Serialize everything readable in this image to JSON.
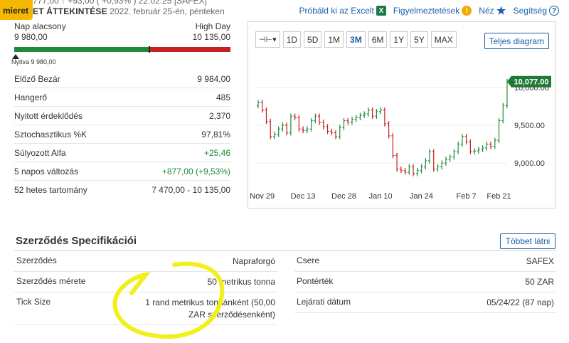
{
  "header": {
    "badge": "mieret",
    "cut_line": "777,00 ↑ +93,00 ( +0,93% )  22:02:25 [SAFEX]",
    "overview_label": "ET ÁTTEKINTÉSE",
    "date_text": "2022. február 25-én, pénteken",
    "links": {
      "excel": "Próbáld ki az Excelt",
      "alerts": "Figyelmeztetések",
      "view": "Néz",
      "help": "Segítség"
    }
  },
  "range": {
    "low_label": "Nap alacsony",
    "low_value": "9 980,00",
    "high_label": "High Day",
    "high_value": "10 135,00",
    "open_label": "Nyitva 9 980,00"
  },
  "stats": [
    {
      "label": "Előző Bezár",
      "value": "9 984,00",
      "positive": false
    },
    {
      "label": "Hangerő",
      "value": "485",
      "positive": false
    },
    {
      "label": "Nyitott érdeklődés",
      "value": "2,370",
      "positive": false
    },
    {
      "label": "Sztochasztikus %K",
      "value": "97,81%",
      "positive": false
    },
    {
      "label": "Súlyozott Alfa",
      "value": "+25,46",
      "positive": true
    },
    {
      "label": "5 napos változás",
      "value": "+877,00 (+9,53%)",
      "positive": true
    },
    {
      "label": "52 hetes tartomány",
      "value": "7 470,00 - 10 135,00",
      "positive": false
    }
  ],
  "chart_toolbar": {
    "type_icon": "bar-chart-icon",
    "periods": [
      "1D",
      "5D",
      "1M",
      "3M",
      "6M",
      "1Y",
      "5Y",
      "MAX"
    ],
    "active": "3M",
    "full_button": "Teljes diagram"
  },
  "chart_data": {
    "type": "ohlc",
    "x_ticks": [
      "Nov 29",
      "Dec 13",
      "Dec 28",
      "Jan 10",
      "Jan 24",
      "Feb 7",
      "Feb 21"
    ],
    "y_ticks": [
      "9,000.00",
      "9,500.00",
      "10,000.00"
    ],
    "y_tick_values": [
      9000,
      9500,
      10000
    ],
    "ylim": [
      8700,
      10300
    ],
    "last_price_label": "10,077.00",
    "last_price": 10077,
    "up_color": "#1f8a3a",
    "down_color": "#c62020",
    "closes": [
      9800,
      9700,
      9550,
      9350,
      9380,
      9450,
      9500,
      9400,
      9620,
      9600,
      9450,
      9430,
      9450,
      9560,
      9620,
      9540,
      9480,
      9420,
      9400,
      9350,
      9470,
      9560,
      9540,
      9580,
      9600,
      9630,
      9650,
      9700,
      9620,
      9680,
      9700,
      9520,
      9360,
      9100,
      8920,
      8900,
      8880,
      8950,
      8860,
      8900,
      8950,
      9030,
      9150,
      8920,
      8950,
      9000,
      9050,
      9080,
      9150,
      9250,
      9350,
      9280,
      9150,
      9160,
      9180,
      9200,
      9250,
      9220,
      9300,
      9560,
      9760,
      10077
    ]
  },
  "spec": {
    "title": "Szerződés Specifikációi",
    "more_button": "Többet látni",
    "left": [
      {
        "label": "Szerződés",
        "value": "Napraforgó"
      },
      {
        "label": "Szerződés mérete",
        "value": "50 metrikus tonna"
      },
      {
        "label": "Tick Size",
        "value": "1 rand metrikus tonnánként (50,00 ZAR szerződésenként)"
      }
    ],
    "right": [
      {
        "label": "Csere",
        "value": "SAFEX"
      },
      {
        "label": "Pontérték",
        "value": "50 ZAR"
      },
      {
        "label": "Lejárati dátum",
        "value": "05/24/22 (87 nap)"
      }
    ]
  }
}
